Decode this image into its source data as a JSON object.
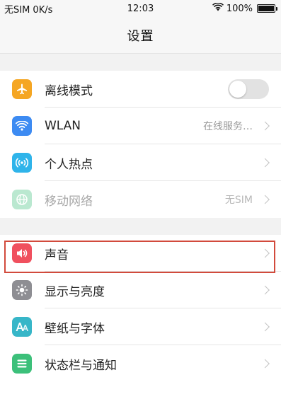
{
  "status_bar": {
    "carrier": "无SIM 0K/s",
    "time": "12:03",
    "battery": "100%",
    "battery_level": 1.0,
    "wifi_icon": "wifi-icon"
  },
  "title": "设置",
  "groups": [
    {
      "items": [
        {
          "label": "离线模式",
          "icon": "airplane-icon",
          "color": "#f5a623",
          "toggle": false
        },
        {
          "label": "WLAN",
          "value": "在线服务…",
          "icon": "wifi-icon",
          "color": "#3d8bf2"
        },
        {
          "label": "个人热点",
          "icon": "hotspot-icon",
          "color": "#2fb4ea"
        },
        {
          "label": "移动网络",
          "value": "无SIM",
          "icon": "globe-icon",
          "color": "#3cc07a",
          "disabled": true
        }
      ]
    },
    {
      "items": [
        {
          "label": "声音",
          "icon": "speaker-icon",
          "color": "#f0505e"
        },
        {
          "label": "显示与亮度",
          "icon": "brightness-icon",
          "color": "#8e8e93"
        },
        {
          "label": "壁纸与字体",
          "icon": "font-icon",
          "color": "#37b6c8"
        },
        {
          "label": "状态栏与通知",
          "icon": "notification-icon",
          "color": "#3cc07a"
        }
      ]
    }
  ],
  "highlight_color": "#d24a3c"
}
